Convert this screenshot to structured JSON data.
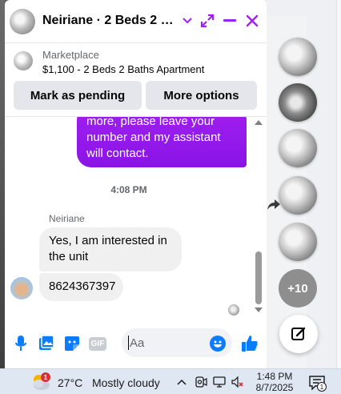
{
  "chat": {
    "title": "Neiriane · 2 Beds 2 Bat...",
    "listing": {
      "kicker": "Marketplace",
      "price_title": "$1,100 - 2 Beds 2 Baths Apartment",
      "mark_pending_label": "Mark as pending",
      "more_options_label": "More options"
    },
    "messages": {
      "outgoing_text": "more, please leave your number and my assistant will contact.",
      "timestamp": "4:08 PM",
      "sender_name": "Neiriane",
      "incoming": [
        "Yes, I am interested in the unit",
        "8624367397"
      ]
    },
    "composer": {
      "placeholder": "Aa",
      "gif_label": "GIF"
    }
  },
  "sidebar": {
    "more_count": "+10"
  },
  "taskbar": {
    "weather_badge": "1",
    "temperature": "27°C",
    "condition": "Mostly cloudy",
    "time": "1:48 PM",
    "date": "8/7/2025",
    "notification_count": "1"
  },
  "colors": {
    "accent": "#a020f0",
    "like": "#0a7cff",
    "bubble_incoming": "#f0f0f0"
  }
}
